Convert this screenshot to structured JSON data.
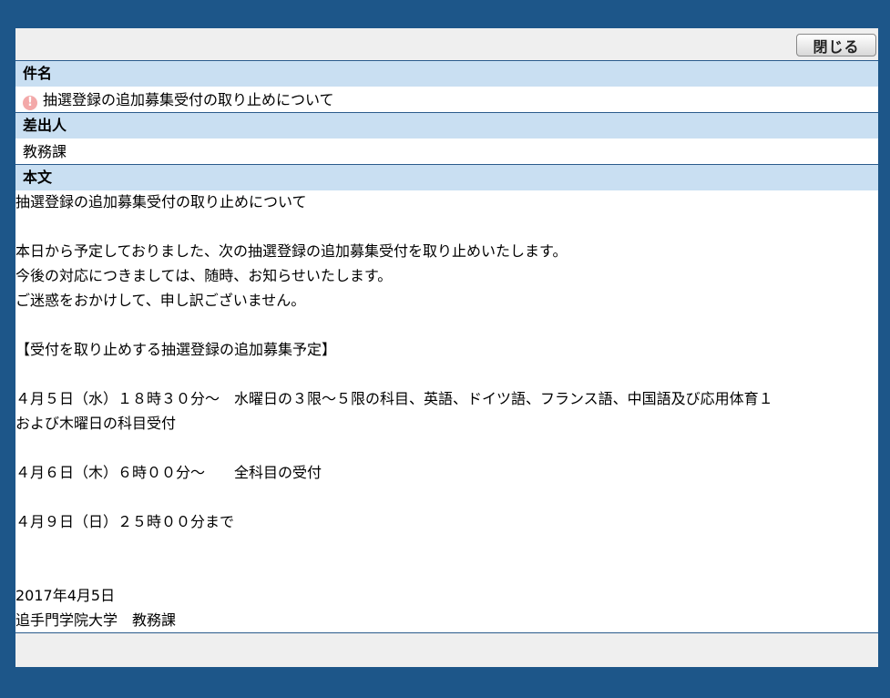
{
  "toolbar": {
    "close_label": "閉じる"
  },
  "subject": {
    "header": "件名",
    "value": "抽選登録の追加募集受付の取り止めについて",
    "icon": "alert-icon",
    "icon_glyph": "!"
  },
  "sender": {
    "header": "差出人",
    "value": "教務課"
  },
  "body": {
    "header": "本文",
    "lines": [
      "抽選登録の追加募集受付の取り止めについて",
      "",
      "本日から予定しておりました、次の抽選登録の追加募集受付を取り止めいたします。",
      "今後の対応につきましては、随時、お知らせいたします。",
      "ご迷惑をおかけして、申し訳ございません。",
      "",
      "【受付を取り止めする抽選登録の追加募集予定】",
      "",
      "４月５日（水）１８時３０分～　水曜日の３限～５限の科目、英語、ドイツ語、フランス語、中国語及び応用体育１",
      "および木曜日の科目受付",
      "",
      "４月６日（木）６時００分～　　全科目の受付",
      "",
      "４月９日（日）２５時００分まで",
      "",
      "",
      "2017年4月5日",
      "追手門学院大学　教務課"
    ]
  },
  "colors": {
    "frame": "#1d5689",
    "header_bg": "#c9dff2",
    "toolbar_bg": "#efefef",
    "alert": "#f3a9a9"
  }
}
